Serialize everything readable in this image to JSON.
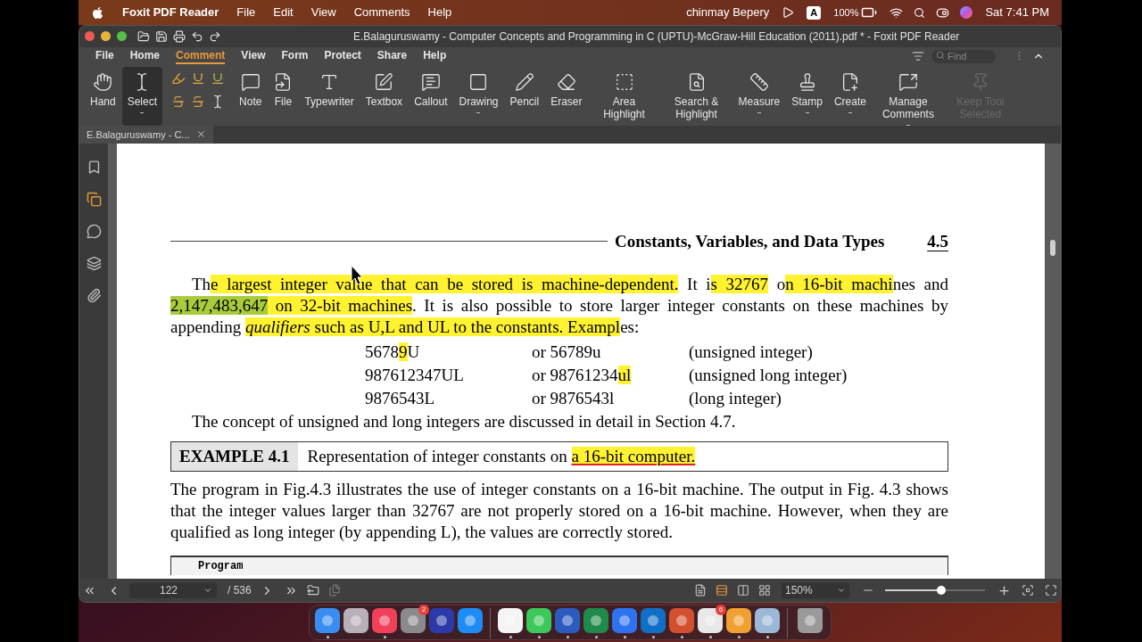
{
  "menubar": {
    "app": "Foxit PDF Reader",
    "menus": [
      "File",
      "Edit",
      "View",
      "Comments",
      "Help"
    ],
    "user": "chinmay Bepery",
    "input_source": "A",
    "battery": "100%",
    "clock": "Sat 7:41 PM"
  },
  "window": {
    "title": "E.Balaguruswamy - Computer Concepts and Programming in C (UPTU)-McGraw-Hill Education (2011).pdf * - Foxit PDF Reader"
  },
  "ribbon_tabs": [
    {
      "label": "File",
      "selected": false
    },
    {
      "label": "Home",
      "selected": false
    },
    {
      "label": "Comment",
      "selected": true
    },
    {
      "label": "View",
      "selected": false
    },
    {
      "label": "Form",
      "selected": false
    },
    {
      "label": "Protect",
      "selected": false
    },
    {
      "label": "Share",
      "selected": false
    },
    {
      "label": "Help",
      "selected": false
    }
  ],
  "find": {
    "placeholder": "Find"
  },
  "tools": [
    {
      "kind": "tool",
      "label": "Hand",
      "selected": false,
      "dropdown": false,
      "disabled": false
    },
    {
      "kind": "tool",
      "label": "Select",
      "selected": true,
      "dropdown": true,
      "disabled": false
    },
    {
      "kind": "markup"
    },
    {
      "kind": "tool",
      "label": "Note",
      "selected": false,
      "dropdown": false,
      "disabled": false
    },
    {
      "kind": "tool",
      "label": "File",
      "selected": false,
      "dropdown": false,
      "disabled": false
    },
    {
      "kind": "tool",
      "label": "Typewriter",
      "selected": false,
      "dropdown": false,
      "disabled": false
    },
    {
      "kind": "tool",
      "label": "Textbox",
      "selected": false,
      "dropdown": false,
      "disabled": false
    },
    {
      "kind": "tool",
      "label": "Callout",
      "selected": false,
      "dropdown": false,
      "disabled": false
    },
    {
      "kind": "tool",
      "label": "Drawing",
      "selected": false,
      "dropdown": true,
      "disabled": false
    },
    {
      "kind": "tool",
      "label": "Pencil",
      "selected": false,
      "dropdown": false,
      "disabled": false
    },
    {
      "kind": "tool",
      "label": "Eraser",
      "selected": false,
      "dropdown": false,
      "disabled": false
    },
    {
      "kind": "tool",
      "label": "Area Highlight",
      "selected": false,
      "dropdown": false,
      "disabled": false
    },
    {
      "kind": "tool",
      "label": "Search & Highlight",
      "selected": false,
      "dropdown": false,
      "disabled": false
    },
    {
      "kind": "tool",
      "label": "Measure",
      "selected": false,
      "dropdown": true,
      "disabled": false
    },
    {
      "kind": "tool",
      "label": "Stamp",
      "selected": false,
      "dropdown": true,
      "disabled": false
    },
    {
      "kind": "tool",
      "label": "Create",
      "selected": false,
      "dropdown": true,
      "disabled": false
    },
    {
      "kind": "tool",
      "label": "Manage Comments",
      "selected": false,
      "dropdown": true,
      "disabled": false
    },
    {
      "kind": "tool",
      "label": "Keep Tool Selected",
      "selected": false,
      "dropdown": false,
      "disabled": true
    }
  ],
  "doc_tab": {
    "label": "E.Balaguruswamy - C..."
  },
  "sidebar": [
    {
      "selected": false
    },
    {
      "selected": true
    },
    {
      "selected": false
    },
    {
      "selected": false
    },
    {
      "selected": false
    }
  ],
  "page": {
    "running_head": "Constants, Variables, and Data Types",
    "page_number": "4.5",
    "paragraph_1": [
      {
        "text": "Th"
      },
      {
        "text": "e largest integer value that can be stored is machine-dependent.",
        "color": "#fff230"
      },
      {
        "text": " It i"
      },
      {
        "text": "s 32767",
        "color": "#fff230"
      },
      {
        "text": " o"
      },
      {
        "text": "n 16-bit machi",
        "color": "#fff230"
      },
      {
        "text": "nes and "
      },
      {
        "text": "2,147,483,647",
        "color": "#a8cc3c"
      },
      {
        "text": " on 32-bit machines",
        "color": "#fff230"
      },
      {
        "text": ". It is also possible to store larger integer constants on these machines by appending "
      },
      {
        "text": "qualifiers",
        "color": "#fff230",
        "italic": true
      },
      {
        "text": " such as U,L and UL to the constants. Exampl",
        "color": "#fff230"
      },
      {
        "text": "es:"
      }
    ],
    "examples": [
      [
        [
          {
            "text": "5678"
          },
          {
            "text": "9",
            "color": "#fff230"
          },
          {
            "text": "U"
          }
        ],
        [
          {
            "text": "or 56789u"
          }
        ],
        [
          {
            "text": "(unsigned integer)"
          }
        ]
      ],
      [
        [
          {
            "text": "987612347UL"
          }
        ],
        [
          {
            "text": "or 98761234"
          },
          {
            "text": "ul ",
            "color": "#fff230"
          }
        ],
        [
          {
            "text": "(unsigned long integer)"
          }
        ]
      ],
      [
        [
          {
            "text": "9876543L"
          }
        ],
        [
          {
            "text": "or 9876543l"
          }
        ],
        [
          {
            "text": "(long integer)"
          }
        ]
      ]
    ],
    "sentence": "The concept of unsigned and long integers are discussed in detail in Section 4.7.",
    "example": {
      "label": "EXAMPLE 4.1",
      "title": [
        {
          "text": "Representation of integer constants on "
        },
        {
          "text": "a 16-bit computer.",
          "color": "#fff230",
          "underline": true
        }
      ]
    },
    "paragraph_2": "The program in Fig.4.3 illustrates the use of integer constants on a 16-bit machine. The output in Fig. 4.3 shows that the integer values larger than 32767 are not properly stored on a 16-bit machine. However, when they are qualified as long integer (by appending L), the values are correctly stored.",
    "program_label": "Program"
  },
  "bottom_bar": {
    "page": "122",
    "total": "/ 536",
    "views": [
      {
        "selected": false
      },
      {
        "selected": true
      },
      {
        "selected": false
      },
      {
        "selected": false
      }
    ],
    "zoom": "150%",
    "zoom_slider": {
      "level": 0.56
    }
  },
  "dock": [
    {
      "kind": "app",
      "color": "#3a8df0",
      "running": true
    },
    {
      "kind": "app",
      "color": "#b8b0b8",
      "running": false
    },
    {
      "kind": "app",
      "color": "#f0405a",
      "running": true
    },
    {
      "kind": "app",
      "color": "#8a8a8e",
      "running": false,
      "badge": "2"
    },
    {
      "kind": "app",
      "color": "#2b3aa8",
      "running": false
    },
    {
      "kind": "app",
      "color": "#1e8cf5",
      "running": false
    },
    {
      "kind": "separator"
    },
    {
      "kind": "app",
      "color": "#f4f4f4",
      "running": true
    },
    {
      "kind": "app",
      "color": "#3cc85a",
      "running": true
    },
    {
      "kind": "app",
      "color": "#2b5bbf",
      "running": true
    },
    {
      "kind": "app",
      "color": "#1f8a4c",
      "running": true
    },
    {
      "kind": "app",
      "color": "#2d72f0",
      "running": true
    },
    {
      "kind": "app",
      "color": "#1070c8",
      "running": true
    },
    {
      "kind": "app",
      "color": "#d2502e",
      "running": true
    },
    {
      "kind": "app",
      "color": "#e8e8e8",
      "running": true,
      "badge": "6"
    },
    {
      "kind": "app",
      "color": "#f0a030",
      "running": true
    },
    {
      "kind": "app",
      "color": "#9cb8d8",
      "running": true
    },
    {
      "kind": "separator"
    },
    {
      "kind": "trash",
      "color": "#9a9a9a",
      "running": false
    }
  ]
}
